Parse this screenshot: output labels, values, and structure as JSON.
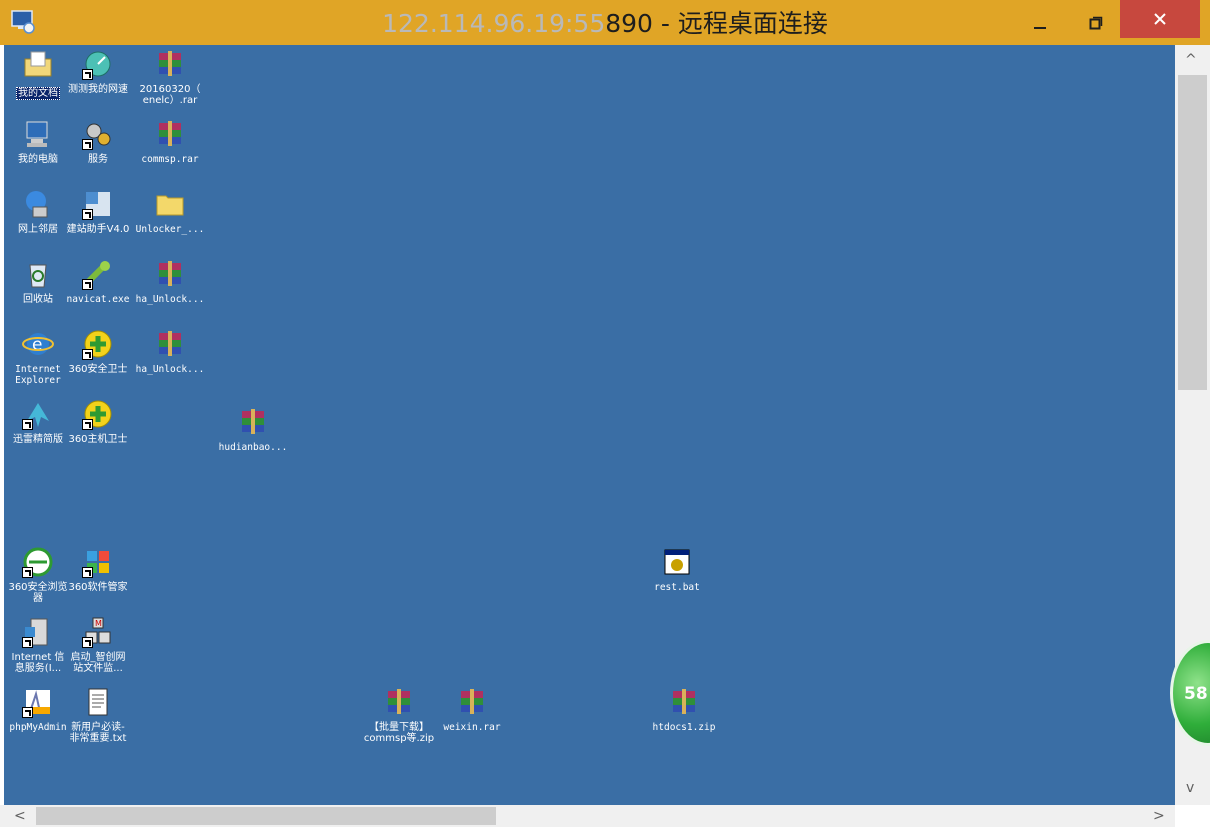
{
  "window": {
    "title": "122.114.96.19:55890 - 远程桌面连接",
    "title_prefix_masked": "122.114.96.19:55",
    "title_suffix": "890 - 远程桌面连接"
  },
  "desktop_icons": [
    {
      "label": "我的文档",
      "icon": "my-documents-icon",
      "selected": true
    },
    {
      "label": "测测我的网速",
      "icon": "speed-test-icon"
    },
    {
      "label": "20160320（\nenelc）.rar",
      "icon": "winrar-archive-icon"
    },
    {
      "label": "我的电脑",
      "icon": "my-computer-icon"
    },
    {
      "label": "服务",
      "icon": "services-icon"
    },
    {
      "label": "commsp.rar",
      "icon": "winrar-archive-icon"
    },
    {
      "label": "网上邻居",
      "icon": "network-places-icon"
    },
    {
      "label": "建站助手V4.0",
      "icon": "site-assistant-icon"
    },
    {
      "label": "Unlocker_...",
      "icon": "folder-icon"
    },
    {
      "label": "回收站",
      "icon": "recycle-bin-icon"
    },
    {
      "label": "navicat.exe",
      "icon": "navicat-icon"
    },
    {
      "label": "ha_Unlock...",
      "icon": "winrar-archive-icon"
    },
    {
      "label": "Internet\nExplorer",
      "icon": "internet-explorer-icon"
    },
    {
      "label": "360安全卫士",
      "icon": "360-safeguard-icon"
    },
    {
      "label": "ha_Unlock...",
      "icon": "winrar-archive-icon"
    },
    {
      "label": "迅雷精简版",
      "icon": "thunder-icon"
    },
    {
      "label": "360主机卫士",
      "icon": "360-host-guard-icon"
    },
    {
      "label": "hudianbao...",
      "icon": "winrar-archive-icon"
    },
    {
      "label": "360安全浏览\n器",
      "icon": "360-browser-icon"
    },
    {
      "label": "360软件管家",
      "icon": "360-software-manager-icon"
    },
    {
      "label": "rest.bat",
      "icon": "batch-file-icon"
    },
    {
      "label": "Internet 信\n息服务(I...",
      "icon": "iis-icon"
    },
    {
      "label": "启动_智创网\n站文件监...",
      "icon": "file-monitor-icon"
    },
    {
      "label": "phpMyAdmin",
      "icon": "phpmyadmin-icon"
    },
    {
      "label": "新用户必读-\n非常重要.txt",
      "icon": "text-file-icon"
    },
    {
      "label": "【批量下载】\ncommsp等.zip",
      "icon": "winrar-archive-icon"
    },
    {
      "label": "weixin.rar",
      "icon": "winrar-archive-icon"
    },
    {
      "label": "htdocs1.zip",
      "icon": "winrar-archive-icon"
    }
  ],
  "floating_ball": {
    "value": "58"
  },
  "colors": {
    "titlebar": "#e0a526",
    "desktop": "#3a6ea5",
    "close": "#c7483e"
  }
}
